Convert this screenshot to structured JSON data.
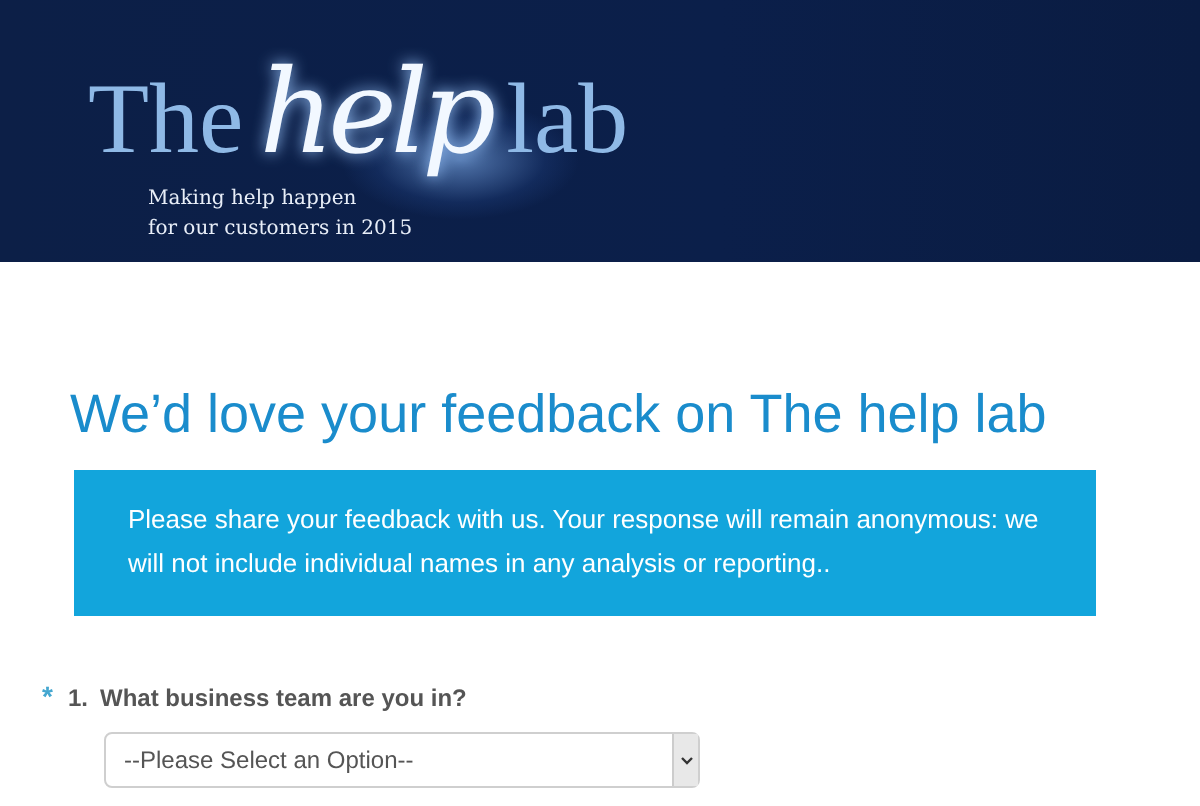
{
  "banner": {
    "logo": {
      "word_1": "The",
      "word_2": "help",
      "word_3": "lab"
    },
    "tagline": [
      "Making help happen",
      "for our customers in 2015"
    ]
  },
  "page_title": "We’d love your feedback on The help lab",
  "notice": "Please share your feedback with us. Your response will remain anonymous: we will not include individual names in any analysis or reporting..",
  "questions": [
    {
      "marker": "*",
      "number": "1.",
      "text": "What business team are you in?",
      "value": "--Please Select an Option--"
    }
  ]
}
